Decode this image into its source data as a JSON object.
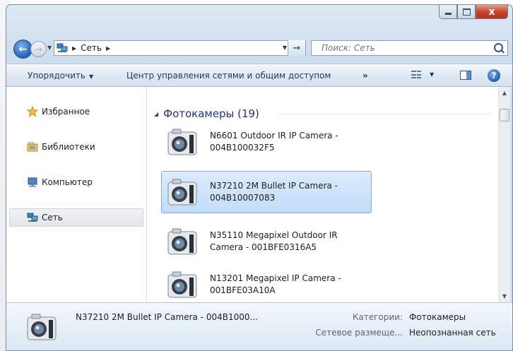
{
  "window": {
    "caption_minimize": "minimize",
    "caption_maximize": "maximize",
    "caption_close": "x"
  },
  "address": {
    "crumb": "Сеть",
    "search_placeholder": "Поиск: Сеть"
  },
  "toolbar": {
    "organize": "Упорядочить",
    "network_center": "Центр управления сетями и общим доступом",
    "more": "»",
    "help": "?"
  },
  "sidebar": {
    "items": [
      {
        "label": "Избранное",
        "icon": "star-icon"
      },
      {
        "label": "Библиотеки",
        "icon": "libraries-icon"
      },
      {
        "label": "Компьютер",
        "icon": "computer-icon"
      },
      {
        "label": "Сеть",
        "icon": "network-icon",
        "selected": true
      }
    ]
  },
  "content": {
    "group_header": "Фотокамеры (19)",
    "items": [
      {
        "line1": "N6601 Outdoor IR IP Camera -",
        "line2": "004B100032F5",
        "selected": false
      },
      {
        "line1": "N37210 2M Bullet IP Camera -",
        "line2": "004B10007083",
        "selected": true
      },
      {
        "line1": "N35110 Megapixel Outdoor IR",
        "line2": "Camera - 001BFE0316A5",
        "selected": false
      },
      {
        "line1": "N13201 Megapixel IP Camera -",
        "line2": "001BFE03A10A",
        "selected": false
      }
    ]
  },
  "details": {
    "name": "N37210 2M Bullet IP Camera - 004B1000...",
    "category_label": "Категории:",
    "category_value": "Фотокамеры",
    "location_label": "Сетевое размеще...",
    "location_value": "Неопознанная сеть"
  }
}
